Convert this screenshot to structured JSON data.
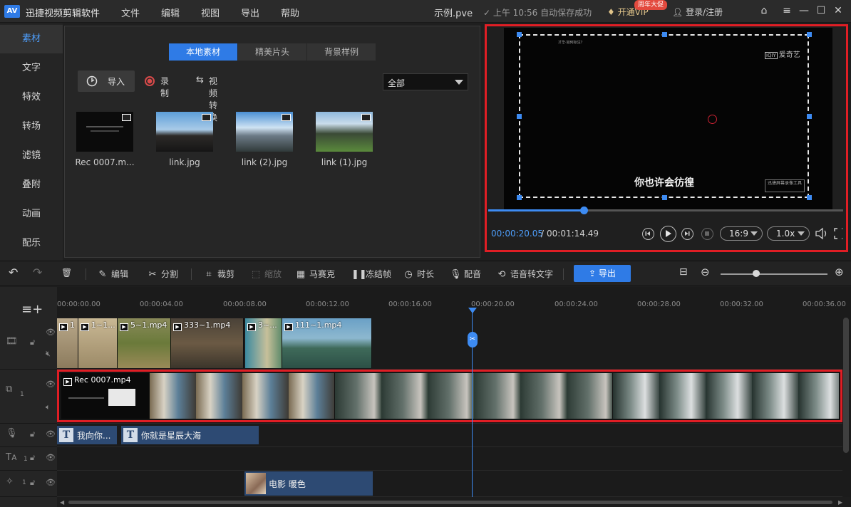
{
  "app": {
    "logo_text": "AV",
    "title": "迅捷视频剪辑软件",
    "menus": [
      "文件",
      "编辑",
      "视图",
      "导出",
      "帮助"
    ],
    "project_name": "示例.pve",
    "autosave_status": "✓ 上午 10:56 自动保存成功",
    "vip_button": "开通VIP",
    "vip_badge": "周年大促",
    "login": "登录/注册"
  },
  "window_controls": {
    "home": "⌂",
    "menu": "≡",
    "minimize": "—",
    "maximize": "☐",
    "close": "✕"
  },
  "sidebar": {
    "items": [
      {
        "label": "素材",
        "active": true
      },
      {
        "label": "文字"
      },
      {
        "label": "特效"
      },
      {
        "label": "转场"
      },
      {
        "label": "滤镜"
      },
      {
        "label": "叠附"
      },
      {
        "label": "动画"
      },
      {
        "label": "配乐"
      }
    ]
  },
  "library": {
    "tabs": [
      {
        "label": "本地素材",
        "active": true
      },
      {
        "label": "精美片头"
      },
      {
        "label": "背景样例"
      }
    ],
    "import_label": "导入",
    "record_label": "录制",
    "convert_label": "视频转换",
    "filter_value": "全部",
    "media": [
      {
        "name": "Rec 0007.m...",
        "type": "video"
      },
      {
        "name": "link.jpg",
        "type": "image"
      },
      {
        "name": "link (2).jpg",
        "type": "image"
      },
      {
        "name": "link (1).jpg",
        "type": "image"
      }
    ]
  },
  "preview": {
    "subtitle": "你也许会彷徨",
    "logo_text": "爱奇艺",
    "logo_mark": "iQIY",
    "tiny_caption": "才华·如何标注？",
    "watermark": "迅捷屏幕录像工具",
    "current_time": "00:00:20.05",
    "time_separator": "/",
    "total_time": "00:01:14.49",
    "progress": 0.2693,
    "aspect_ratio": "16:9",
    "speed": "1.0x"
  },
  "toolbar": {
    "edit": "编辑",
    "split": "分割",
    "crop": "裁剪",
    "zoom": "缩放",
    "mosaic": "马赛克",
    "freeze": "冻结帧",
    "duration": "时长",
    "dub": "配音",
    "speech_to_text": "语音转文字",
    "export": "导出",
    "zoom_level": 0.33
  },
  "timeline": {
    "ruler": [
      "00:00:00.00",
      "00:00:04.00",
      "00:00:08.00",
      "00:00:12.00",
      "00:00:16.00",
      "00:00:20.00",
      "00:00:24.00",
      "00:00:28.00",
      "00:00:32.00",
      "00:00:36.00"
    ],
    "track_numbers": {
      "main": "1",
      "text": "1",
      "subtitle": "1",
      "effect": "1"
    },
    "video_clips": [
      "1",
      "1~1...",
      "5~1.mp4",
      "333~1.mp4",
      "3~...",
      "111~1.mp4"
    ],
    "main_clip": "Rec 0007.mp4",
    "text_clips": [
      "我向你...",
      "你就是星辰大海"
    ],
    "filter_clip": "电影 暖色"
  },
  "colors": {
    "accent": "#2f7be6",
    "highlight_frame": "#e01e25",
    "text_clip": "#2d4a73"
  }
}
